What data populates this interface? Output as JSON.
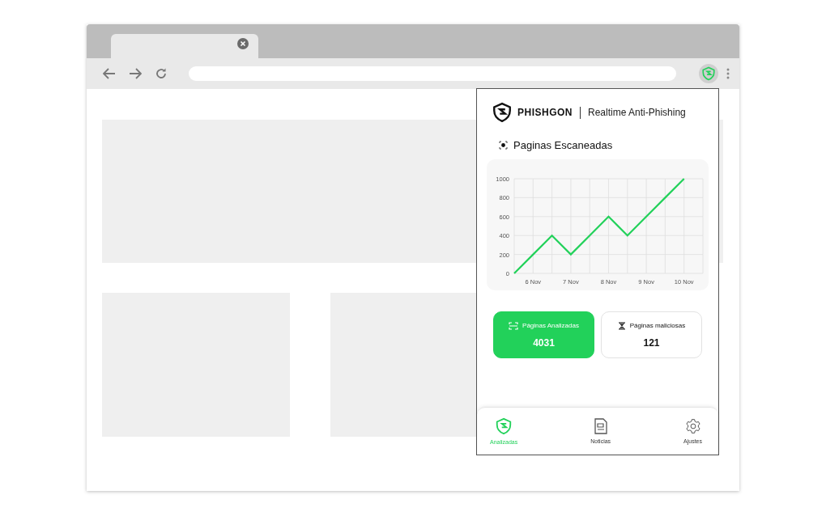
{
  "popup": {
    "brand": "PHISHGON",
    "tagline": "Realtime Anti-Phishing",
    "section_title": "Paginas Escaneadas",
    "chart_data": {
      "type": "line",
      "categories": [
        null,
        "6 Nov",
        null,
        "7 Nov",
        null,
        "8 Nov",
        null,
        "9 Nov",
        null,
        "10 Nov"
      ],
      "series": [
        {
          "color": "#22d15a",
          "values": [
            0,
            200,
            400,
            200,
            400,
            600,
            400,
            600,
            800,
            1000
          ]
        }
      ],
      "grid": true,
      "ylim": [
        0,
        1000
      ],
      "yticks": [
        0,
        200,
        400,
        600,
        800,
        1000
      ]
    },
    "stats": [
      {
        "label": "Páginas Analizadas",
        "value": "4031",
        "selected": true
      },
      {
        "label": "Páginas maliciosas",
        "value": "121",
        "selected": false
      }
    ],
    "nav": [
      {
        "label": "Analizadas",
        "kind": "shield",
        "selected": true
      },
      {
        "label": "Noticias",
        "kind": "news",
        "selected": false
      },
      {
        "label": "Ajustes",
        "kind": "gear",
        "selected": false
      }
    ]
  }
}
